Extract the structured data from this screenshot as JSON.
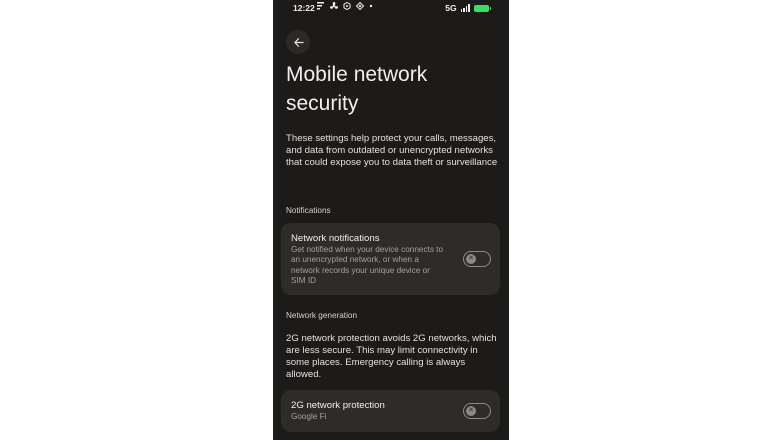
{
  "status_bar": {
    "time": "12:22",
    "network": "5G",
    "battery_color": "#3ddc64",
    "left_icons": [
      "notification-icon",
      "fan-icon",
      "settings-gear-icon",
      "diamond-icon",
      "dot-icon"
    ]
  },
  "page": {
    "title": "Mobile network security",
    "intro": "These settings help protect your calls, messages, and data from outdated or unencrypted networks that could expose you to data theft or surveillance"
  },
  "notifications_section": {
    "label": "Notifications",
    "card_title": "Network notifications",
    "card_desc": "Get notified when your device connects to an unencrypted network, or when a network records your unique device or SIM ID",
    "toggle_on": false
  },
  "network_generation_section": {
    "label": "Network generation",
    "description": "2G network protection avoids 2G networks, which are less secure. This may limit connectivity in some places. Emergency calling is always allowed.",
    "card_title": "2G network protection",
    "card_subtitle": "Google Fi",
    "toggle_on": false
  },
  "colors": {
    "background": "#1c1b19",
    "card": "#2d2c29",
    "text_primary": "#f1efea",
    "text_secondary": "#a5a29c"
  }
}
